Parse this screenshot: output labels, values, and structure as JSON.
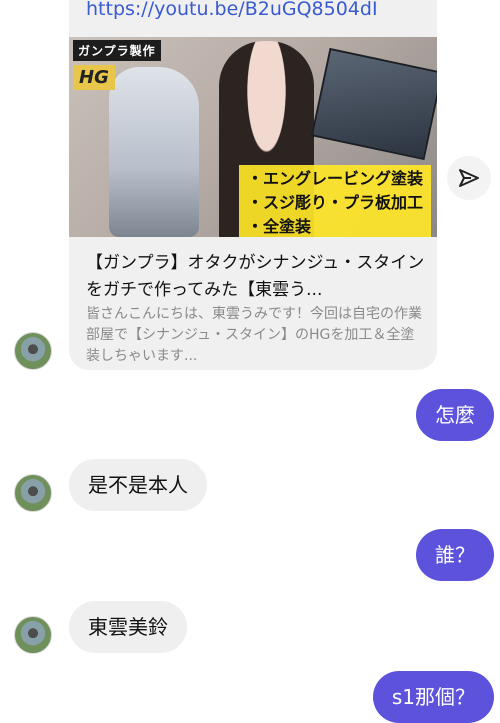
{
  "link_card": {
    "url": "https://youtu.be/B2uGQ8504dI",
    "thumbnail": {
      "banner": "ガンプラ製作",
      "hg": "HG",
      "caption": "・エングレービング塗装\n・スジ彫り・プラ板加工\n・全塗装"
    },
    "title": "【ガンプラ】オタクがシナンジュ・スタインをガチで作ってみた【東雲う...",
    "description": "皆さんこんにちは、東雲うみです！今回は自宅の作業部屋で【シナンジュ・スタイン】のHGを加工＆全塗装しちゃいます..."
  },
  "messages": [
    {
      "side": "out",
      "text": "怎麼"
    },
    {
      "side": "in",
      "text": "是不是本人"
    },
    {
      "side": "out",
      "text": "誰？"
    },
    {
      "side": "in",
      "text": "東雲美鈴"
    },
    {
      "side": "out",
      "text": "s1那個？"
    }
  ],
  "icons": {
    "share": "share-arrow-icon",
    "avatar": "contact-avatar"
  },
  "colors": {
    "outgoing_bubble": "#5c52dc",
    "incoming_bubble": "#efefef",
    "link": "#3a5ad0"
  }
}
